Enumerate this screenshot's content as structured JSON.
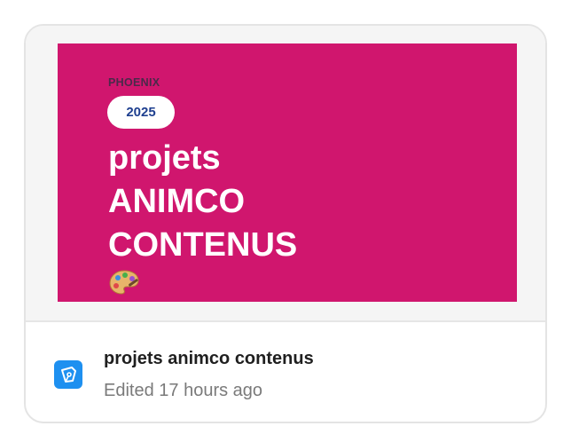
{
  "card": {
    "thumbnail": {
      "kicker": "PHOENIX",
      "year": "2025",
      "headline_lines": [
        "projets",
        "ANIMCO",
        "CONTENUS"
      ],
      "decoration_icon": "artist-palette-icon",
      "background_color": "#d0166e"
    },
    "file_icon": "pen-nib-icon",
    "file_icon_color": "#1e90f0",
    "title": "projets animco contenus",
    "subtitle": "Edited 17 hours ago"
  }
}
